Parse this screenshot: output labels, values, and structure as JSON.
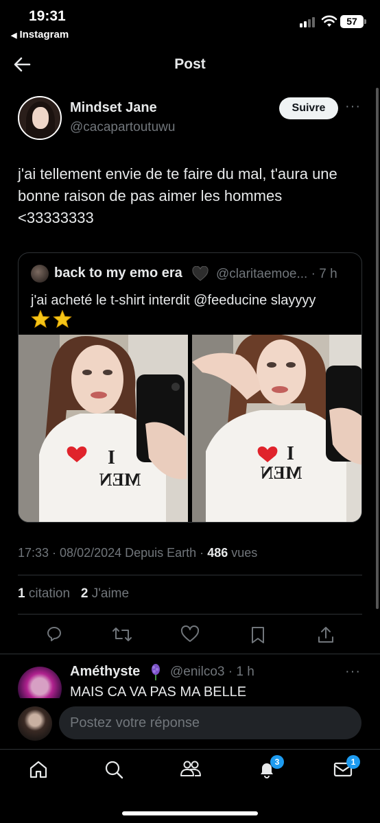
{
  "status_bar": {
    "time": "19:31",
    "back_app": "Instagram",
    "battery": "57"
  },
  "header": {
    "title": "Post"
  },
  "post": {
    "author_name": "Mindset Jane",
    "author_handle": "@cacapartoutuwu",
    "follow_label": "Suivre",
    "text": "j'ai tellement envie de te faire du mal, t'aura une bonne raison de pas aimer les hommes <33333333",
    "quote": {
      "name": "back to my emo era",
      "handle": "@claritaemoe... · 7 h",
      "text": "j'ai acheté le t-shirt interdit @feeducine slayyyy",
      "shirt_text_top": "I",
      "shirt_text_bottom": "MEN"
    },
    "meta": {
      "time_date": "17:33 · 08/02/2024 Depuis Earth · ",
      "views_count": "486",
      "views_label": " vues"
    },
    "stats": {
      "citations_count": "1",
      "citations_label": " citation",
      "likes_count": "2",
      "likes_label": " J'aime"
    }
  },
  "reply": {
    "name": "Améthyste",
    "handle": "@enilco3 · 1 h",
    "text": "MAIS CA VA PAS MA BELLE"
  },
  "composer": {
    "placeholder": "Postez votre réponse"
  },
  "tabbar": {
    "notifications_badge": "3",
    "messages_badge": "1"
  },
  "colors": {
    "accent": "#1d9bf0",
    "muted": "#71767b",
    "text": "#e7e9ea",
    "divider": "#2f3336"
  }
}
